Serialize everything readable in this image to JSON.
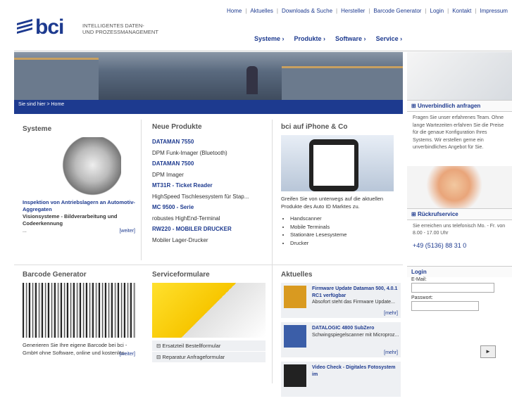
{
  "topnav": [
    "Home",
    "Aktuelles",
    "Downloads & Suche",
    "Hersteller",
    "Barcode Generator",
    "Login",
    "Kontakt",
    "Impressum"
  ],
  "logo": {
    "text": "bci",
    "tagline1": "INTELLIGENTES DATEN-",
    "tagline2": "UND PROZESSMANAGEMENT"
  },
  "mainnav": [
    "Systeme ›",
    "Produkte ›",
    "Software ›",
    "Service ›"
  ],
  "breadcrumb": "Sie sind hier > Home",
  "systeme": {
    "title": "Systeme",
    "link": "Inspektion von Antriebslagern an Automotiv-Aggregaten",
    "sub": "Visionsysteme - Bildverarbeitung und Codeerkennung",
    "ellipsis": "...",
    "more": "[weiter]"
  },
  "neue": {
    "title": "Neue Produkte",
    "items": [
      {
        "name": "DATAMAN 7550",
        "desc": "DPM Funk-Imager (Bluetooth)"
      },
      {
        "name": "DATAMAN 7500",
        "desc": "DPM Imager"
      },
      {
        "name": "MT31R - Ticket Reader",
        "desc": "HighSpeed Tischlesesystem für Stap..."
      },
      {
        "name": "MC 9500 - Serie",
        "desc": "robustes HighEnd-Terminal"
      },
      {
        "name": "RW220 - MOBILER DRUCKER",
        "desc": "Mobiler Lager-Drucker"
      }
    ]
  },
  "iphone": {
    "title": "bci auf iPhone & Co",
    "text": "Greifen Sie von unterwegs auf die aktuellen Produkte des Auto ID Marktes zu.",
    "list": [
      "Handscanner",
      "Mobile Terminals",
      "Stationäre Lesesysteme",
      "Drucker"
    ]
  },
  "barcode": {
    "title": "Barcode Generator",
    "text": "Generieren Sie Ihre eigene Barcode bei bci - GmbH ohne Software, online und kostenlos.",
    "more": "[weiter]"
  },
  "service": {
    "title": "Serviceformulare",
    "items": [
      "Ersatzteil Bestellformular",
      "Reparatur Anfrageformular"
    ]
  },
  "aktuelles": {
    "title": "Aktuelles",
    "items": [
      {
        "title": "Firmware Update Dataman 500, 4.0.1 RC1 verfügbar",
        "text": "Absofort steht das Firmware Update...",
        "more": "[mehr]"
      },
      {
        "title": "DATALOGIC 4800 SubZero",
        "text": "Schwingspiegelscanner mit Microproz...",
        "more": "[mehr]"
      },
      {
        "title": "Video Check - Digitales Fotosystem im",
        "text": "",
        "more": ""
      }
    ]
  },
  "side": {
    "anfragen": {
      "title": "Unverbindlich anfragen",
      "text": "Fragen Sie unser erfahrenes Team. Ohne lange Wartezeiten erfahren Sie die Preise für die genaue Konfiguration Ihres Systems. Wir erstellen gerne ein unverbindliches Angebot für Sie."
    },
    "rueckruf": {
      "title": "Rückrufservice",
      "text": "Sie erreichen uns telefonisch Mo. - Fr. von 8.00 - 17.00 Uhr",
      "phone": "+49 (5136) 88 31 0"
    },
    "login": {
      "title": "Login",
      "email": "E-Mail:",
      "password": "Passwort:",
      "go": "►"
    }
  }
}
